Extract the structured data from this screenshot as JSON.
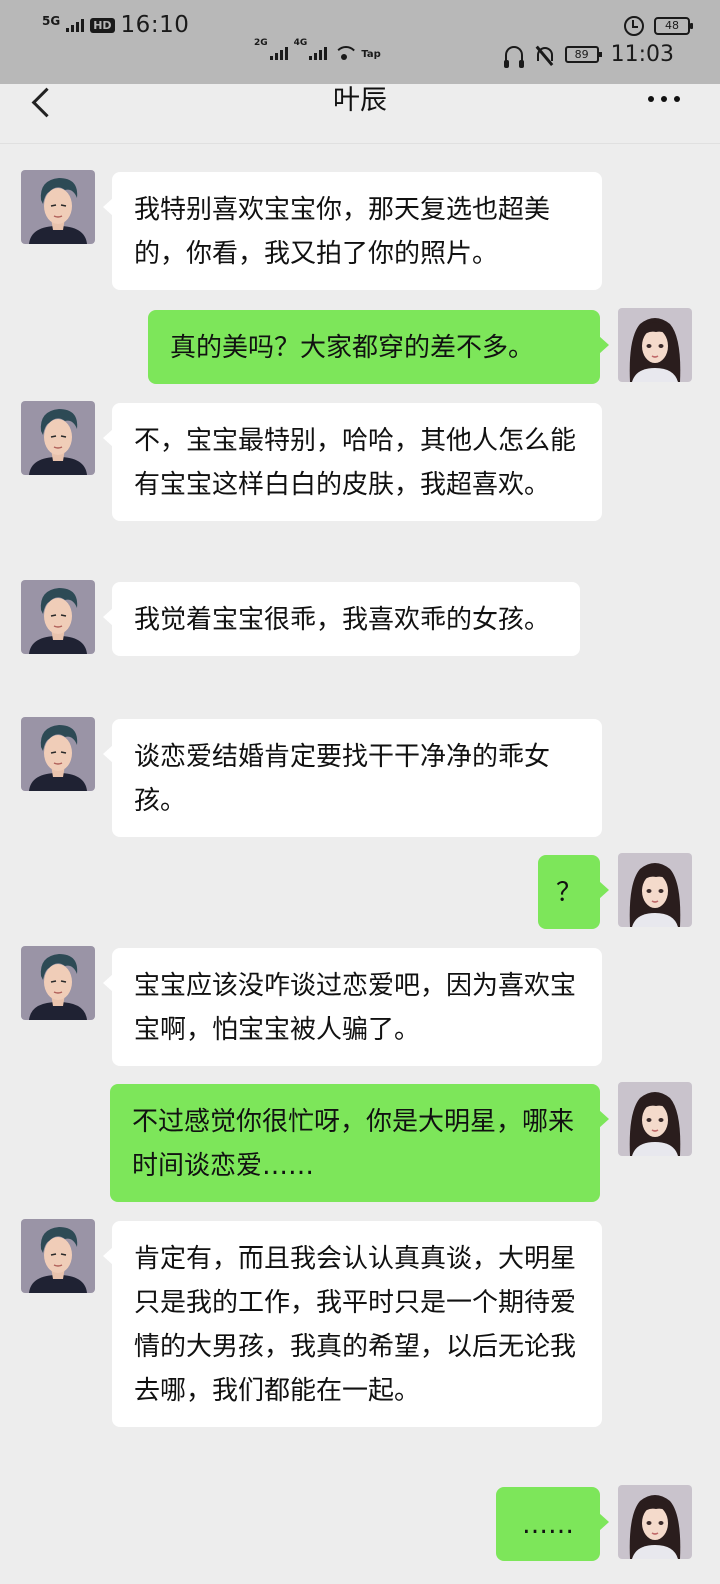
{
  "status_outer": {
    "network": "5G",
    "hd": "HD",
    "time": "16:10",
    "battery": "48"
  },
  "status_inner": {
    "net_a": "2G",
    "net_b": "4G",
    "tap": "Tap",
    "battery": "89",
    "time": "11:03"
  },
  "header": {
    "title": "叶辰"
  },
  "colors": {
    "incoming_bubble": "#ffffff",
    "outgoing_bubble": "#7de65a",
    "background": "#ededed"
  },
  "messages": [
    {
      "from": "contact",
      "text": "我特别喜欢宝宝你，那天复选也超美的，你看，我又拍了你的照片。"
    },
    {
      "from": "me",
      "text": "真的美吗？大家都穿的差不多。"
    },
    {
      "from": "contact",
      "text": "不，宝宝最特别，哈哈，其他人怎么能有宝宝这样白白的皮肤，我超喜欢。"
    },
    {
      "from": "contact",
      "text": "我觉着宝宝很乖，我喜欢乖的女孩。"
    },
    {
      "from": "contact",
      "text": "谈恋爱结婚肯定要找干干净净的乖女孩。"
    },
    {
      "from": "me",
      "text": "？"
    },
    {
      "from": "contact",
      "text": "宝宝应该没咋谈过恋爱吧，因为喜欢宝宝啊，怕宝宝被人骗了。"
    },
    {
      "from": "me",
      "text": "不过感觉你很忙呀，你是大明星，哪来时间谈恋爱……"
    },
    {
      "from": "contact",
      "text": "肯定有，而且我会认认真真谈，大明星只是我的工作，我平时只是一个期待爱情的大男孩，我真的希望，以后无论我去哪，我们都能在一起。"
    },
    {
      "from": "me",
      "text": "……"
    }
  ]
}
